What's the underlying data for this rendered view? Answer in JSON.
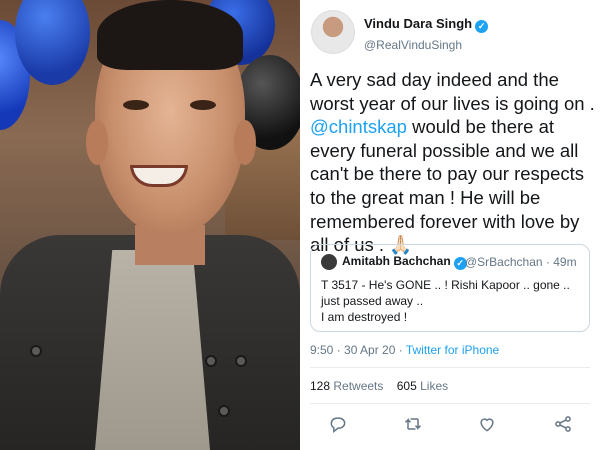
{
  "tweet": {
    "display_name": "Vindu Dara Singh",
    "handle": "@RealVinduSingh",
    "text_before_mention": "A very sad day indeed and the worst year of our lives is going on .",
    "mention": "@chintskap",
    "text_after_mention": " would be there at every funeral possible  and we all can't be there to pay our respects to the great man ! He will be remembered forever with love by all of us . 🙏🏻",
    "quoted": {
      "display_name": "Amitabh Bachchan",
      "handle_time": "@SrBachchan · 49m",
      "line1": "T 3517 - He's GONE .. ! Rishi Kapoor .. gone .. just passed away ..",
      "line2": "I am destroyed !"
    },
    "time_date": "9:50 · 30 Apr 20 · ",
    "source": "Twitter for iPhone",
    "retweets_count": "128",
    "retweets_label": " Retweets",
    "likes_count": "605",
    "likes_label": " Likes"
  },
  "icons": {
    "reply": "reply-icon",
    "retweet": "retweet-icon",
    "like": "heart-icon",
    "share": "share-icon",
    "verified": "verified-badge-icon"
  },
  "colors": {
    "link": "#1da1f2",
    "text": "#14171a",
    "muted": "#657786"
  }
}
